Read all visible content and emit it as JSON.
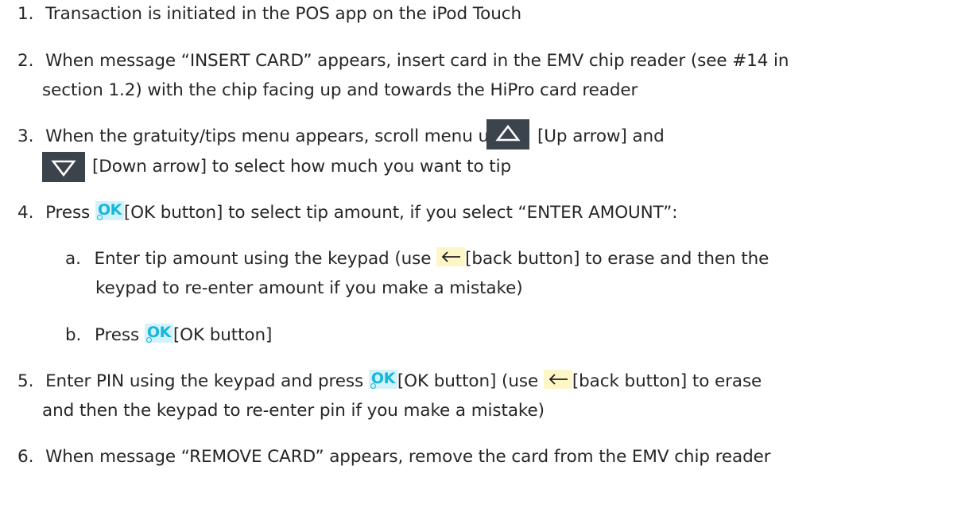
{
  "steps": [
    {
      "num": "1.",
      "line1": "Transaction is initiated in the POS app on the iPod Touch"
    },
    {
      "num": "2.",
      "line1": "When message “INSERT CARD” appears, insert card in the EMV chip reader (see #14 in",
      "line2": "section 1.2)  with the chip facing up and towards the HiPro card reader"
    },
    {
      "num": "3.",
      "line1_a": "When the gratuity/tips menu appears, scroll menu using",
      "line1_b": "[Up arrow] and",
      "line2": "[Down arrow] to select how much you want to tip"
    },
    {
      "num": "4.",
      "line1_a": "Press",
      "line1_b": "[OK button] to select tip amount, if you select “ENTER AMOUNT”:"
    },
    {
      "num": "5.",
      "line1_a": "Enter PIN using the keypad and press",
      "line1_b": "[OK button] (use",
      "line1_c": "[back button] to erase",
      "line2": "and then the keypad to re-enter pin if you make a mistake)"
    },
    {
      "num": "6.",
      "line1": "When message “REMOVE CARD” appears, remove the card from the EMV chip reader"
    }
  ],
  "substeps": [
    {
      "letter": "a.",
      "line1_a": "Enter tip amount using the keypad (use",
      "line1_b": "[back button] to erase and then the",
      "line2": "keypad to re-enter amount if you make a mistake)"
    },
    {
      "letter": "b.",
      "line1_a": "Press",
      "line1_b": "[OK button]"
    }
  ],
  "icons": {
    "ok_label": "OK",
    "colors": {
      "dark_icon_bg": "#3b434c",
      "ok_text": "#17b7dc",
      "ok_bg": "#d3f3fb",
      "back_bg": "#fdf6c6"
    }
  }
}
